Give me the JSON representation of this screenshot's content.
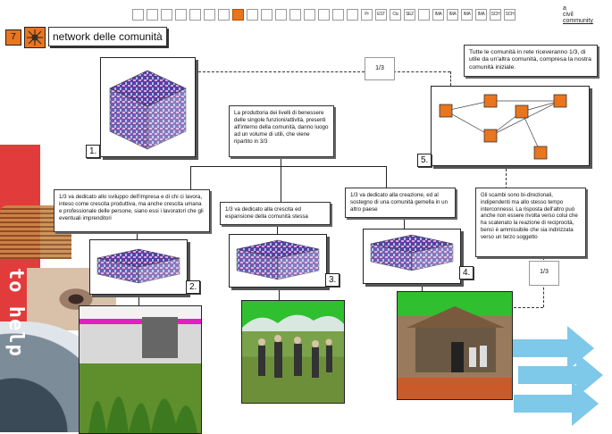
{
  "header": {
    "number": "7",
    "title": "network delle comunità"
  },
  "brand": {
    "line1": "a",
    "line2": "civil",
    "line3": "community"
  },
  "toolbar": {
    "items": [
      "",
      "",
      "",
      "",
      "",
      "",
      "",
      "",
      "",
      "",
      "",
      "",
      "",
      "",
      "",
      "",
      "Pr",
      "EST",
      "Civ EST",
      "SEZ",
      "",
      "IMA GE1",
      "IMA GE2",
      "IMA GE3",
      "IMA GE4",
      "SCH 1",
      "SCH 2"
    ],
    "active_index": 7
  },
  "colors": {
    "accent": "#e9751f",
    "red_strip": "#e23b3b",
    "arrows": "#7ec8ea"
  },
  "boxes": {
    "b1": "1.",
    "b2": "2.",
    "b3": "3.",
    "b4": "4.",
    "b5": "5."
  },
  "fractions": {
    "top": "1/3",
    "right": "1/3"
  },
  "texts": {
    "center": "La produttoria dei livelli di benessere delle singole funzioni/attività, presenti all'interno della comunità, danno luogo ad un volume di utili, che viene ripartito in 3/3",
    "network": "Tutte le comunità in rete riceveranno 1/3, di utile da un'altra comunità, compresa la nostra comunità iniziale.",
    "left": "1/3 va dedicato allo sviluppo dell'impresa e di chi ci lavora, inteso come crescita produttiva, ma anche crescita umana e professionale delle persone, siano essi i lavoratori che gli eventuali imprenditori",
    "middle": "1/3 va dedicato alla crescita ed espansione della comunità stessa",
    "right": "1/3 va dedicato alla creazione, ed al sostegno di una comunità gemella  in un altro paese",
    "exchange": "Gli scambi sono bi-direzionali, indipendenti ma allo stesso tempo interconnessi. La risposta dell'altro può anche non essere rivolta verso colui che ha scatenato la reazione di reciprocità, bensì è ammissibile che sia indirizzata verso un terzo soggetto"
  },
  "side": {
    "label": "to help"
  }
}
